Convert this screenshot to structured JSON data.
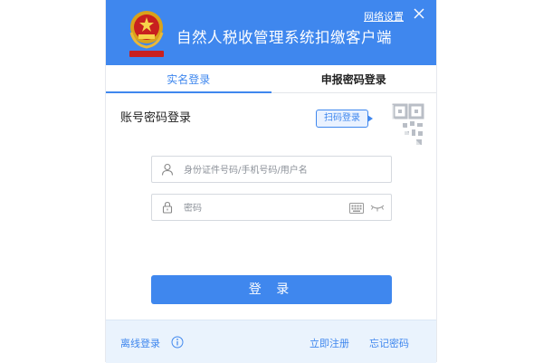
{
  "header": {
    "title": "自然人税收管理系统扣缴客户端",
    "network_settings": "网络设置",
    "close_icon": "close-icon",
    "emblem_icon": "tax-emblem-icon"
  },
  "tabs": [
    {
      "label": "实名登录",
      "active": true
    },
    {
      "label": "申报密码登录",
      "active": false
    }
  ],
  "login": {
    "section_title": "账号密码登录",
    "scan_badge": "扫码登录",
    "username_placeholder": "身份证件号码/手机号码/用户名",
    "password_placeholder": "密码",
    "username_value": "",
    "password_value": "",
    "submit_label": "登 录"
  },
  "footer": {
    "offline": "离线登录",
    "register": "立即注册",
    "forgot": "忘记密码"
  },
  "colors": {
    "accent": "#3f87ee",
    "footer_bg": "#eaf3fd",
    "border": "#d5d9df"
  }
}
